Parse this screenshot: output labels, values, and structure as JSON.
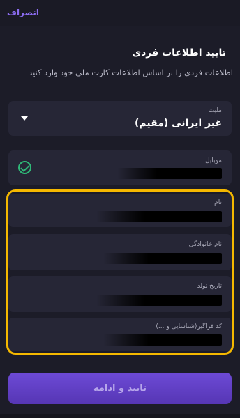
{
  "header": {
    "cancel_label": "انصراف"
  },
  "page": {
    "title": "تایید اطلاعات فردی",
    "subtitle": "اطلاعات فردی را بر اساس اطلاعات کارت ملي خود وارد کنید"
  },
  "form": {
    "nationality": {
      "label": "ملیت",
      "value": "غیر ایرانی (مقیم)"
    },
    "mobile": {
      "label": "موبایل"
    },
    "first_name": {
      "label": "نام"
    },
    "last_name": {
      "label": "نام خانوادگی"
    },
    "birth_date": {
      "label": "تاریخ تولد"
    },
    "foreigner_code": {
      "label": "کد فراگیر(شناسایی و ...)"
    }
  },
  "actions": {
    "submit_label": "تایید و ادامه"
  },
  "colors": {
    "background": "#1c1c28",
    "field": "#262636",
    "accent": "#6d4ad6",
    "highlight": "#f5b800",
    "success": "#2fb878"
  }
}
